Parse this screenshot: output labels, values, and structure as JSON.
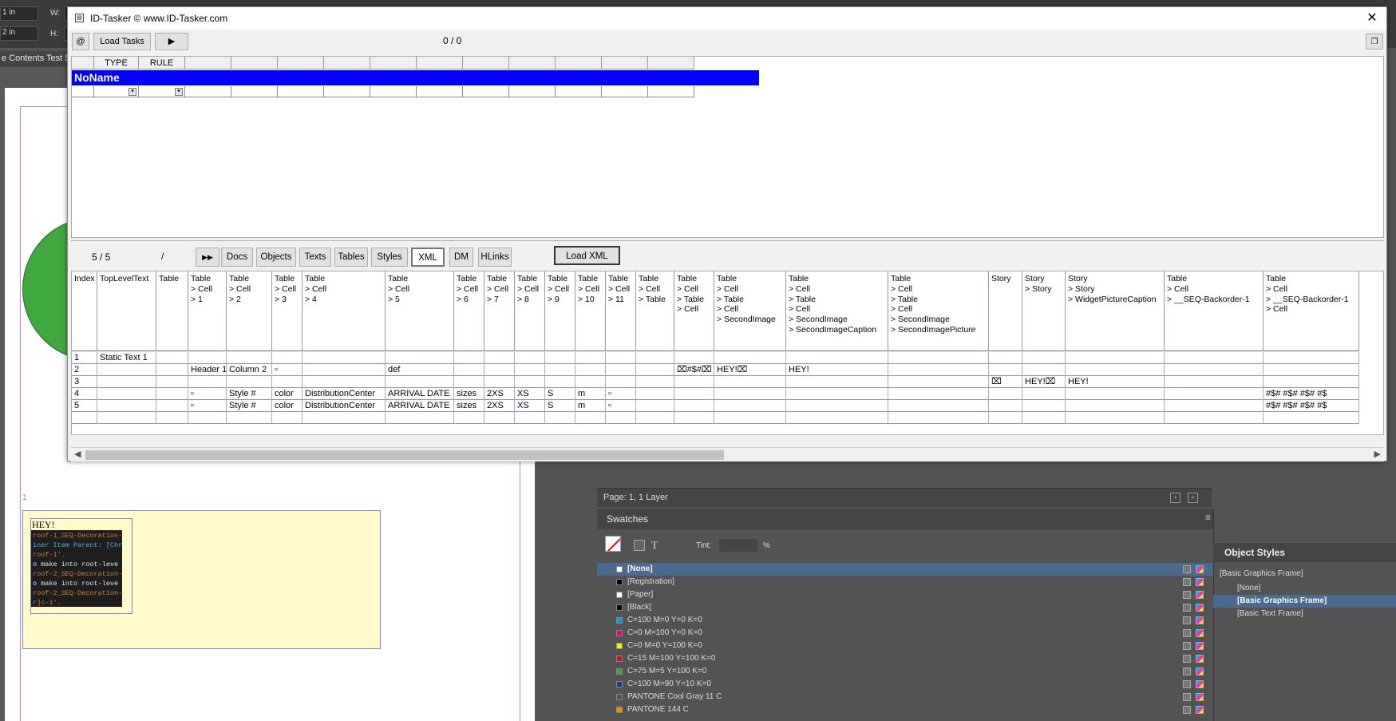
{
  "indesign": {
    "control_bar": {
      "w_label": "W:",
      "h_label": "H:",
      "x_value": "1 in",
      "y_value": "2 in"
    },
    "doc_tab": "e Contents Test 5",
    "text_frame": {
      "heading": "HEY!",
      "code_lines": [
        {
          "text": "roof-1_SEQ-Decoration-",
          "color": "#d97a3a"
        },
        {
          "text": "iner Item Parent: [Chr",
          "color": "#4ab4e0"
        },
        {
          "text": "roof-1'.",
          "color": "#d97a3a"
        },
        {
          "text": "o make into root-leve",
          "color": "#e8e8e8"
        },
        {
          "text": "roof-2_SEQ-Decoration-",
          "color": "#d97a3a"
        },
        {
          "text": "o make into root-leve",
          "color": "#e8e8e8"
        },
        {
          "text": "roof-2_SEQ-Decoration-",
          "color": "#d97a3a"
        },
        {
          "text": "r]c-1'.",
          "color": "#d97a3a"
        }
      ],
      "page_marker": "1"
    },
    "pages_footer": "Page: 1, 1 Layer",
    "swatches": {
      "title": "Swatches",
      "tint_label": "Tint:",
      "tint_unit": "%",
      "items": [
        {
          "name": "[None]",
          "color": "#ffffff",
          "selected": true
        },
        {
          "name": "[Registration]",
          "color": "#000000"
        },
        {
          "name": "[Paper]",
          "color": "#ffffff"
        },
        {
          "name": "[Black]",
          "color": "#000000"
        },
        {
          "name": "C=100 M=0 Y=0 K=0",
          "color": "#009fe3"
        },
        {
          "name": "C=0 M=100 Y=0 K=0",
          "color": "#e5007e"
        },
        {
          "name": "C=0 M=0 Y=100 K=0",
          "color": "#ffed00"
        },
        {
          "name": "C=15 M=100 Y=100 K=0",
          "color": "#d0121b"
        },
        {
          "name": "C=75 M=5 Y=100 K=0",
          "color": "#3aa935"
        },
        {
          "name": "C=100 M=90 Y=10 K=0",
          "color": "#23378b"
        },
        {
          "name": "PANTONE Cool Gray 11 C",
          "color": "#53565a"
        },
        {
          "name": "PANTONE 144 C",
          "color": "#ed8b00"
        }
      ]
    },
    "object_styles": {
      "title": "Object Styles",
      "current": "[Basic Graphics Frame]",
      "items": [
        {
          "name": "[None]"
        },
        {
          "name": "[Basic Graphics Frame]",
          "selected": true
        },
        {
          "name": "[Basic Text Frame]"
        }
      ]
    }
  },
  "idtasker": {
    "title": "ID-Tasker  © www.ID-Tasker.com",
    "toolbar": {
      "at_label": "@",
      "load_tasks": "Load Tasks",
      "play": "▶",
      "counter": "0 / 0"
    },
    "task_grid": {
      "headers": [
        "TYPE",
        "RULE"
      ],
      "group_name": "NoName"
    },
    "results_bar": {
      "counter": "5 / 5",
      "slash": "/",
      "ff": "▶▶",
      "tabs": [
        "Docs",
        "Objects",
        "Texts",
        "Tables",
        "Styles",
        "XML",
        "DM",
        "HLinks"
      ],
      "active_tab": "XML",
      "load_xml": "Load XML"
    },
    "results_grid": {
      "columns": [
        "Index",
        "TopLevelText",
        "Table",
        "Table\n> Cell\n> 1",
        "Table\n> Cell\n> 2",
        "Table\n> Cell\n> 3",
        "Table\n> Cell\n> 4",
        "Table\n> Cell\n> 5",
        "Table\n> Cell\n> 6",
        "Table\n> Cell\n> 7",
        "Table\n> Cell\n> 8",
        "Table\n> Cell\n> 9",
        "Table\n> Cell\n> 10",
        "Table\n> Cell\n> 11",
        "Table\n> Cell\n> Table",
        "Table\n> Cell\n> Table\n> Cell",
        "Table\n> Cell\n> Table\n> Cell\n> SecondImage",
        "Table\n> Cell\n> Table\n> Cell\n> SecondImage\n> SecondImageCaption",
        "Table\n> Cell\n> Table\n> Cell\n> SecondImage\n> SecondImagePicture",
        "Story",
        "Story\n> Story",
        "Story\n> Story\n> WidgetPictureCaption",
        "Table\n> Cell\n> __SEQ-Backorder-1",
        "Table\n> Cell\n> __SEQ-Backorder-1\n> Cell"
      ],
      "rows": [
        [
          "1",
          "Static Text 1",
          "",
          "",
          "",
          "",
          "",
          "",
          "",
          "",
          "",
          "",
          "",
          "",
          "",
          "",
          "",
          "",
          "",
          "",
          "",
          "",
          "",
          ""
        ],
        [
          "2",
          "",
          "",
          "Header 1",
          "Column 2",
          "▫",
          "",
          "def",
          "",
          "",
          "",
          "",
          "",
          "",
          "",
          "⌧#$#⌧",
          "HEY!⌧",
          "HEY!",
          "",
          "",
          "",
          "",
          "",
          ""
        ],
        [
          "3",
          "",
          "",
          "",
          "",
          "",
          "",
          "",
          "",
          "",
          "",
          "",
          "",
          "",
          "",
          "",
          "",
          "",
          "",
          "⌧",
          "HEY!⌧",
          "HEY!",
          "",
          ""
        ],
        [
          "4",
          "",
          "",
          "▫",
          "Style #",
          "color",
          "DistributionCenter",
          "ARRIVAL DATE",
          "sizes",
          "2XS",
          "XS",
          "S",
          "m",
          "▫",
          "",
          "",
          "",
          "",
          "",
          "",
          "",
          "",
          "",
          "#$#   #$#   #$#   #$"
        ],
        [
          "5",
          "",
          "",
          "▫",
          "Style #",
          "color",
          "DistributionCenter",
          "ARRIVAL DATE",
          "sizes",
          "2XS",
          "XS",
          "S",
          "m",
          "▫",
          "",
          "",
          "",
          "",
          "",
          "",
          "",
          "",
          "",
          "#$#   #$#   #$#   #$"
        ],
        [
          "",
          "",
          "",
          "",
          "",
          "",
          "",
          "",
          "",
          "",
          "",
          "",
          "",
          "",
          "",
          "",
          "",
          "",
          "",
          "",
          "",
          "",
          "",
          ""
        ]
      ]
    }
  }
}
